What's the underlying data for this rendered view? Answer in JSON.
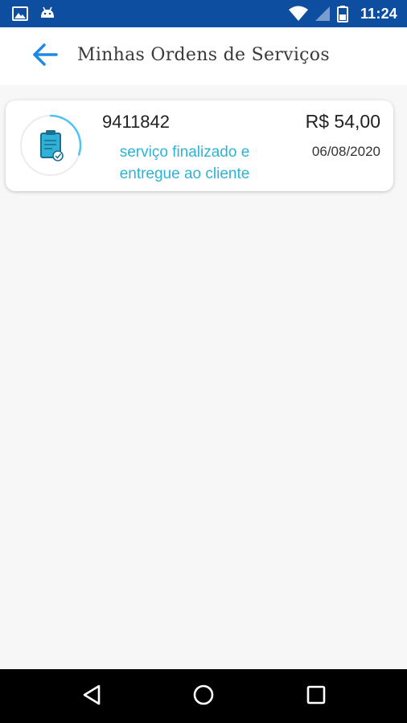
{
  "status_bar": {
    "time": "11:24",
    "icons": [
      "image-icon",
      "android-icon",
      "wifi-icon",
      "signal-icon",
      "battery-icon"
    ]
  },
  "app_bar": {
    "title": "Minhas Ordens de Serviços",
    "back_icon": "arrow-left-icon"
  },
  "orders": [
    {
      "number": "9411842",
      "status": "serviço finalizado e entregue ao cliente",
      "price": "R$ 54,00",
      "date": "06/08/2020",
      "icon": "clipboard-check-icon",
      "progress": 0.3
    }
  ],
  "nav_bar": {
    "icons": [
      "back-triangle-icon",
      "home-circle-icon",
      "recents-square-icon"
    ]
  },
  "colors": {
    "status_bar": "#0d4ea0",
    "accent": "#1e88e5",
    "status_text": "#2fb2d6",
    "background": "#f7f7f7"
  }
}
